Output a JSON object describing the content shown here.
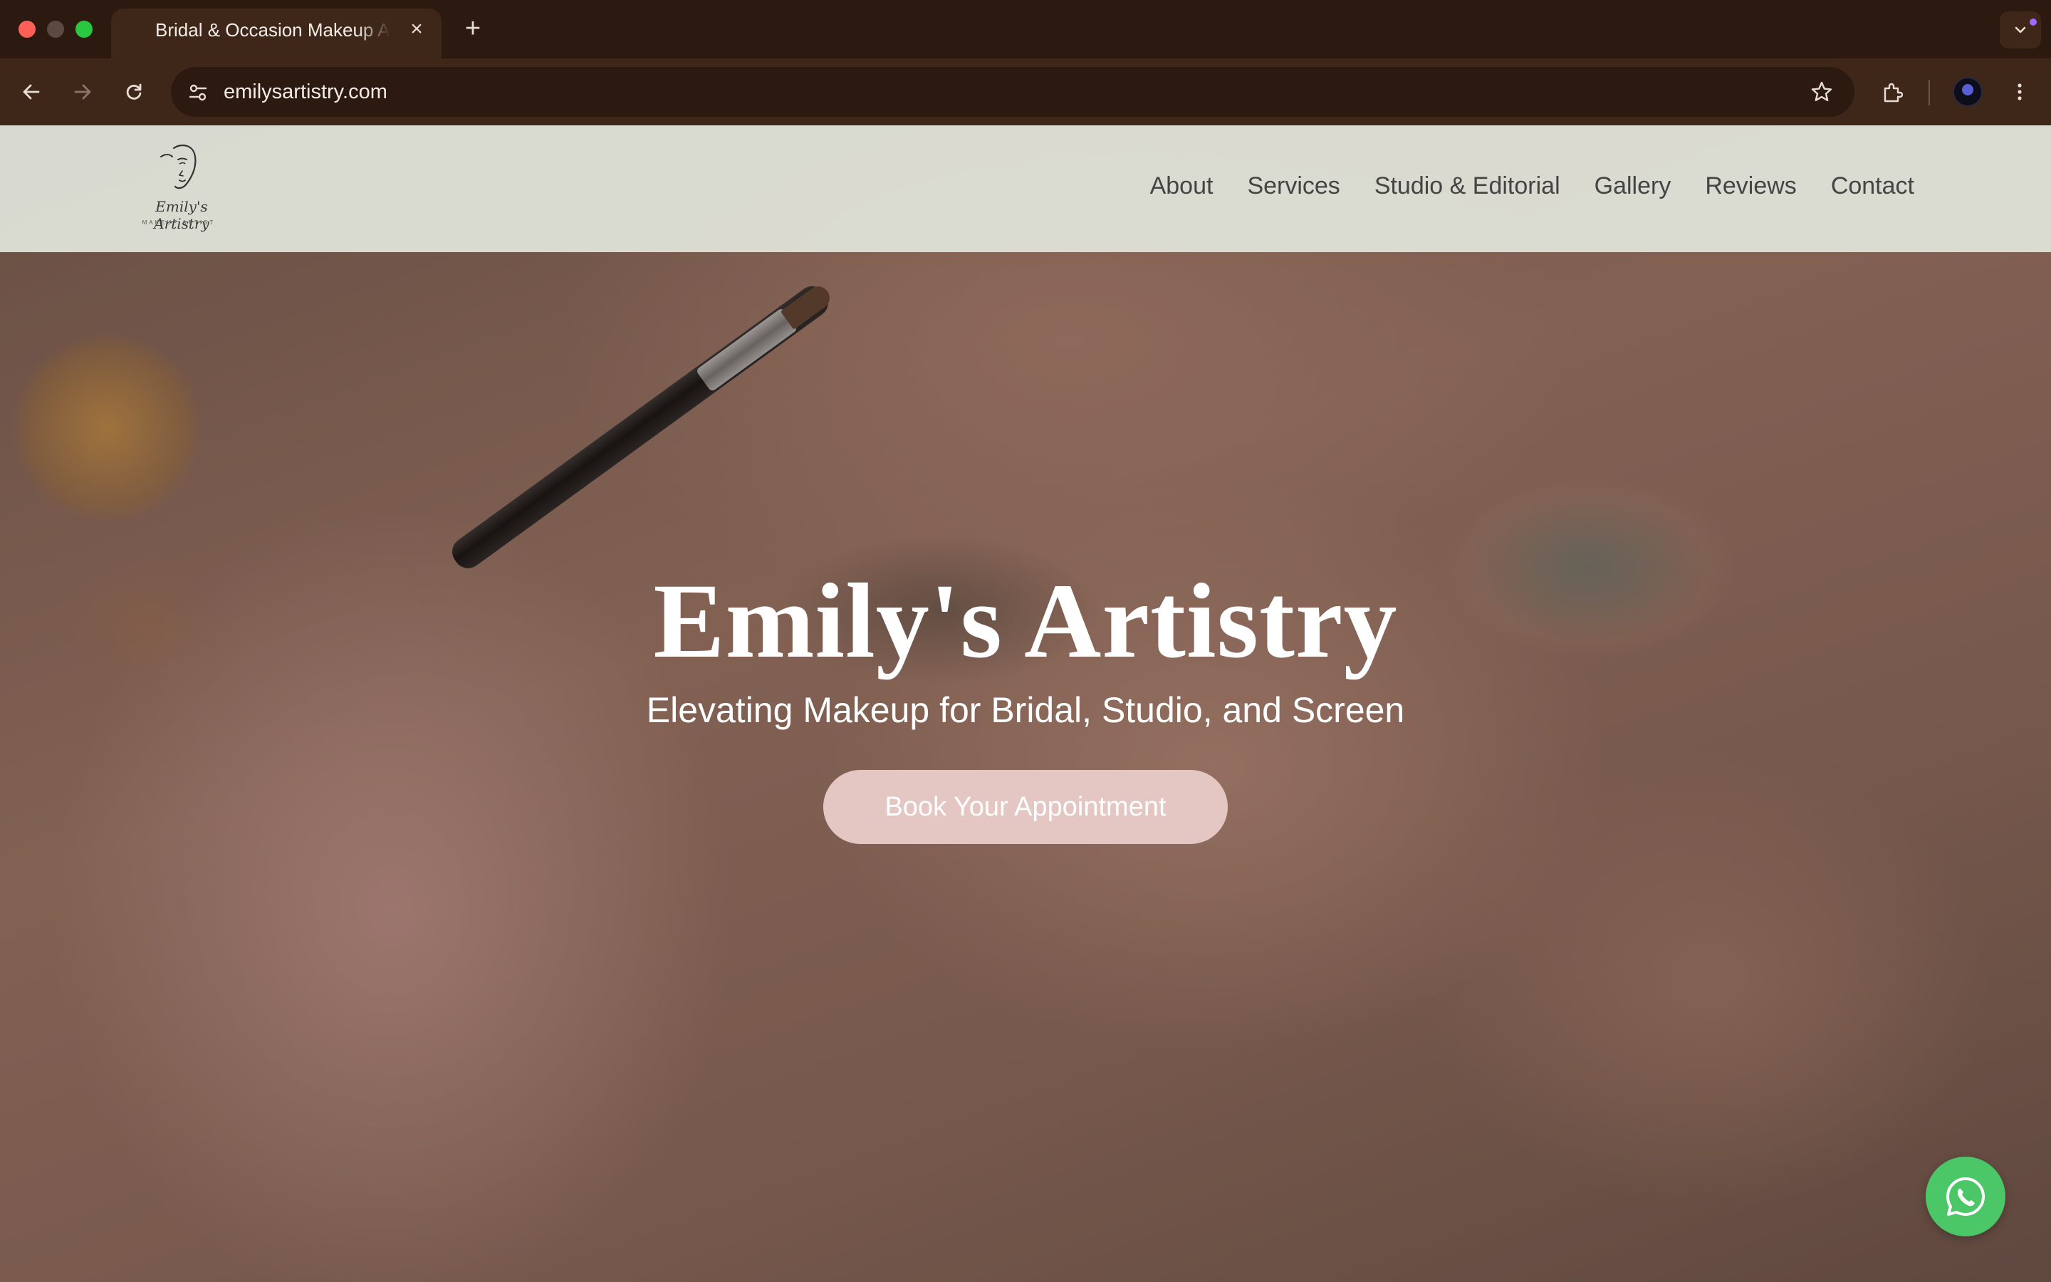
{
  "browser": {
    "tab_title": "Bridal & Occasion Makeup Artist",
    "tab_close": "×",
    "new_tab": "+",
    "url": "emilysartistry.com"
  },
  "header": {
    "logo_text": "Emily's Artistry",
    "logo_subtext": "MAKEUP ARTIST",
    "nav": {
      "about": "About",
      "services": "Services",
      "studio": "Studio & Editorial",
      "gallery": "Gallery",
      "reviews": "Reviews",
      "contact": "Contact"
    }
  },
  "hero": {
    "title": "Emily's Artistry",
    "subtitle": "Elevating Makeup for Bridal, Studio, and Screen",
    "cta_label": "Book Your Appointment"
  },
  "colors": {
    "chrome_bg": "#2c1a10",
    "toolbar_bg": "#3e2719",
    "header_bg": "#e1e4da",
    "cta_bg": "#e4c7c3",
    "whatsapp_green": "#4cc767"
  },
  "icons": [
    "back-arrow-icon",
    "forward-arrow-icon",
    "reload-icon",
    "site-settings-icon",
    "bookmark-star-icon",
    "extensions-icon",
    "menu-kebab-icon",
    "tab-search-icon",
    "whatsapp-icon"
  ]
}
